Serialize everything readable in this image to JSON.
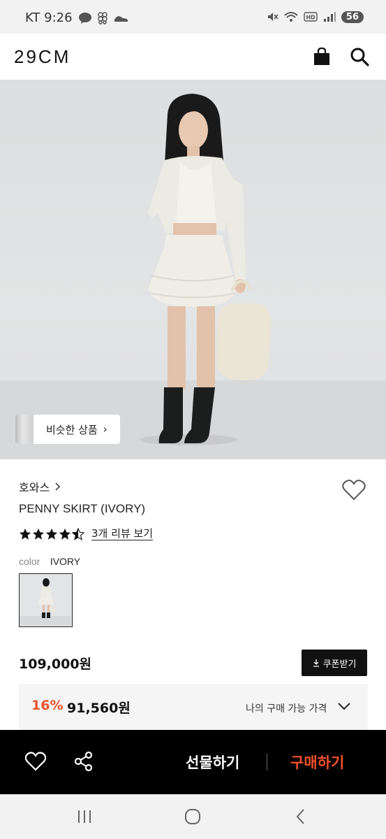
{
  "status_bar": {
    "carrier_time": "KT 9:26",
    "battery": "56"
  },
  "header": {
    "logo": "29CM",
    "icons": [
      "shopping-bag-icon",
      "search-icon"
    ]
  },
  "hero": {
    "similar_button_label": "비슷한 상품"
  },
  "product": {
    "brand": "호와스",
    "name": "PENNY SKIRT (IVORY)",
    "rating": 4.5,
    "review_link": "3개 리뷰 보기",
    "color_label": "color",
    "color_value": "IVORY",
    "price": "109,000원",
    "coupon_label": "쿠폰받기",
    "discount_rate": "16%",
    "discount_price": "91,560원",
    "discount_label": "나의 구매 가능 가격"
  },
  "action_bar": {
    "gift_label": "선물하기",
    "buy_label": "구매하기",
    "buy_color": "#f4512c"
  },
  "colors": {
    "accent_red": "#e8532c",
    "black": "#111111"
  }
}
